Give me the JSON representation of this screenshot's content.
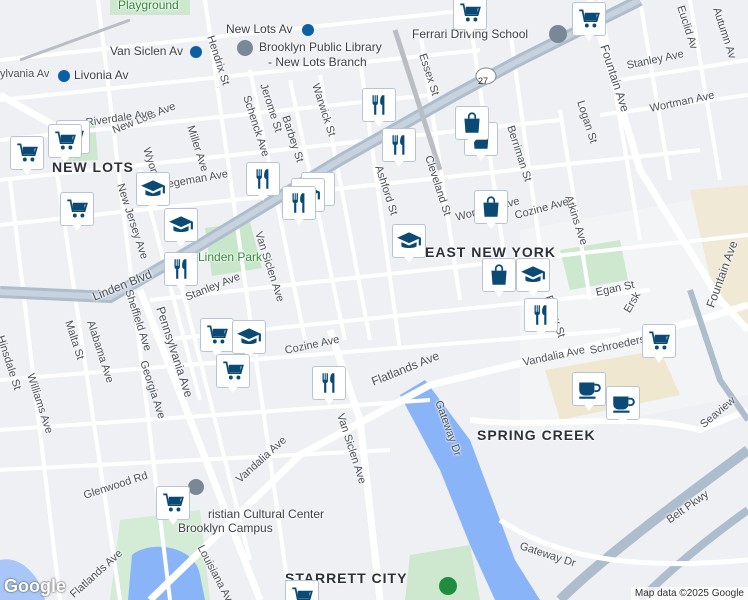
{
  "map": {
    "attribution": "Map data ©2025 Google",
    "logo": "Google",
    "colors": {
      "background": "#eef0f3",
      "road": "#ffffff",
      "highway": "#aebdcc",
      "water": "#8ab4f8",
      "park": "#c8e6c9",
      "rail": "#9e9e9e",
      "industrial": "#f0e9d6",
      "pin_icon": "#0b4a74"
    },
    "area_labels": [
      {
        "id": "new-lots",
        "text": "NEW LOTS"
      },
      {
        "id": "east-new-york",
        "text": "EAST NEW YORK"
      },
      {
        "id": "spring-creek",
        "text": "SPRING CREEK"
      },
      {
        "id": "starrett-city",
        "text": "STARRETT CITY"
      }
    ],
    "poi_labels": [
      {
        "id": "playground",
        "text": "Playground"
      },
      {
        "id": "new-lots-av-station",
        "text": "New Lots Av"
      },
      {
        "id": "van-siclen-av-station",
        "text": "Van Siclen Av"
      },
      {
        "id": "livonia-av-station",
        "text": "Livonia Av"
      },
      {
        "id": "library",
        "text": "Brooklyn Public Library"
      },
      {
        "id": "library-branch",
        "text": "- New Lots Branch"
      },
      {
        "id": "ferrari-driving-school",
        "text": "Ferrari Driving School"
      },
      {
        "id": "linden-park",
        "text": "Linden Park"
      },
      {
        "id": "cultural-center-1",
        "text": "ristian Cultural Center"
      },
      {
        "id": "cultural-center-2",
        "text": "Brooklyn Campus"
      }
    ],
    "street_labels": [
      {
        "id": "s1",
        "text": "New Lots Ave"
      },
      {
        "id": "s2",
        "text": "Riverdale Ave"
      },
      {
        "id": "s3",
        "text": "Hegeman Ave"
      },
      {
        "id": "s4",
        "text": "Linden Blvd"
      },
      {
        "id": "s5",
        "text": "Stanley Ave"
      },
      {
        "id": "s6",
        "text": "Cozine Ave"
      },
      {
        "id": "s7",
        "text": "Flatlands Ave"
      },
      {
        "id": "s8",
        "text": "Vandalia Ave"
      },
      {
        "id": "s9",
        "text": "Van Siclen Ave"
      },
      {
        "id": "s10",
        "text": "Pennsylvania Ave"
      },
      {
        "id": "s11",
        "text": "Fountain Ave"
      },
      {
        "id": "s12",
        "text": "Wortman Ave"
      },
      {
        "id": "s13",
        "text": "Essex St"
      },
      {
        "id": "s14",
        "text": "Berriman St"
      },
      {
        "id": "s15",
        "text": "Logan St"
      },
      {
        "id": "s16",
        "text": "Atkins Ave"
      },
      {
        "id": "s17",
        "text": "Barbey St"
      },
      {
        "id": "s18",
        "text": "Schenck Ave"
      },
      {
        "id": "s19",
        "text": "Jerome St"
      },
      {
        "id": "s20",
        "text": "Warwick St"
      },
      {
        "id": "s21",
        "text": "Hendrix St"
      },
      {
        "id": "s22",
        "text": "Miller Ave"
      },
      {
        "id": "s23",
        "text": "Wyona St"
      },
      {
        "id": "s24",
        "text": "New Jersey Ave"
      },
      {
        "id": "s25",
        "text": "Sheffield Ave"
      },
      {
        "id": "s26",
        "text": "Georgia Ave"
      },
      {
        "id": "s27",
        "text": "Alabama Ave"
      },
      {
        "id": "s28",
        "text": "Malta St"
      },
      {
        "id": "s29",
        "text": "Williams Ave"
      },
      {
        "id": "s30",
        "text": "Glenwood Rd"
      },
      {
        "id": "s31",
        "text": "Louisiana Ave"
      },
      {
        "id": "s32",
        "text": "Gateway Dr"
      },
      {
        "id": "s33",
        "text": "Belt Pkwy"
      },
      {
        "id": "s34",
        "text": "Egan St"
      },
      {
        "id": "s35",
        "text": "Schroeders Ave"
      },
      {
        "id": "s36",
        "text": "Cleveland St"
      },
      {
        "id": "s37",
        "text": "Ashford St"
      },
      {
        "id": "s38",
        "text": "Elton St"
      },
      {
        "id": "s39",
        "text": "Stanley Ave"
      },
      {
        "id": "s40",
        "text": "Wortman Ave"
      },
      {
        "id": "s41",
        "text": "Euclid Av"
      },
      {
        "id": "s42",
        "text": "Autumn Av"
      },
      {
        "id": "s43",
        "text": "Hinsdale St"
      },
      {
        "id": "s44",
        "text": "Seaview"
      },
      {
        "id": "s45",
        "text": "Ersk"
      },
      {
        "id": "s46",
        "text": "Fountain Ave"
      },
      {
        "id": "s47",
        "text": "Cozine Ave"
      },
      {
        "id": "s48",
        "text": "Van Siclen Ave"
      },
      {
        "id": "s49",
        "text": "Vandalia Ave"
      },
      {
        "id": "s50",
        "text": "Flatlands Ave"
      },
      {
        "id": "s51",
        "text": "Essex St"
      }
    ],
    "route_shield": "27",
    "pins": [
      {
        "type": "shopping-cart-icon"
      },
      {
        "type": "shopping-cart-icon"
      },
      {
        "type": "shopping-bag-icon"
      },
      {
        "type": "restaurant-icon"
      },
      {
        "type": "shopping-cart-icon"
      },
      {
        "type": "restaurant-icon"
      },
      {
        "type": "shopping-bag-icon"
      },
      {
        "type": "shopping-cart-icon"
      },
      {
        "type": "shopping-cart-icon"
      },
      {
        "type": "school-icon"
      },
      {
        "type": "restaurant-icon"
      },
      {
        "type": "school-icon"
      },
      {
        "type": "restaurant-icon"
      },
      {
        "type": "shopping-cart-icon"
      },
      {
        "type": "school-icon"
      },
      {
        "type": "shopping-bag-icon"
      },
      {
        "type": "school-icon"
      },
      {
        "type": "restaurant-icon"
      },
      {
        "type": "restaurant-icon"
      },
      {
        "type": "shopping-bag-icon"
      },
      {
        "type": "school-icon"
      },
      {
        "type": "restaurant-icon"
      },
      {
        "type": "shopping-cart-icon"
      },
      {
        "type": "shopping-cart-icon"
      },
      {
        "type": "school-icon"
      },
      {
        "type": "shopping-cart-icon"
      },
      {
        "type": "restaurant-icon"
      },
      {
        "type": "coffee-icon"
      },
      {
        "type": "coffee-icon"
      },
      {
        "type": "shopping-cart-icon"
      },
      {
        "type": "shopping-cart-icon"
      }
    ]
  }
}
